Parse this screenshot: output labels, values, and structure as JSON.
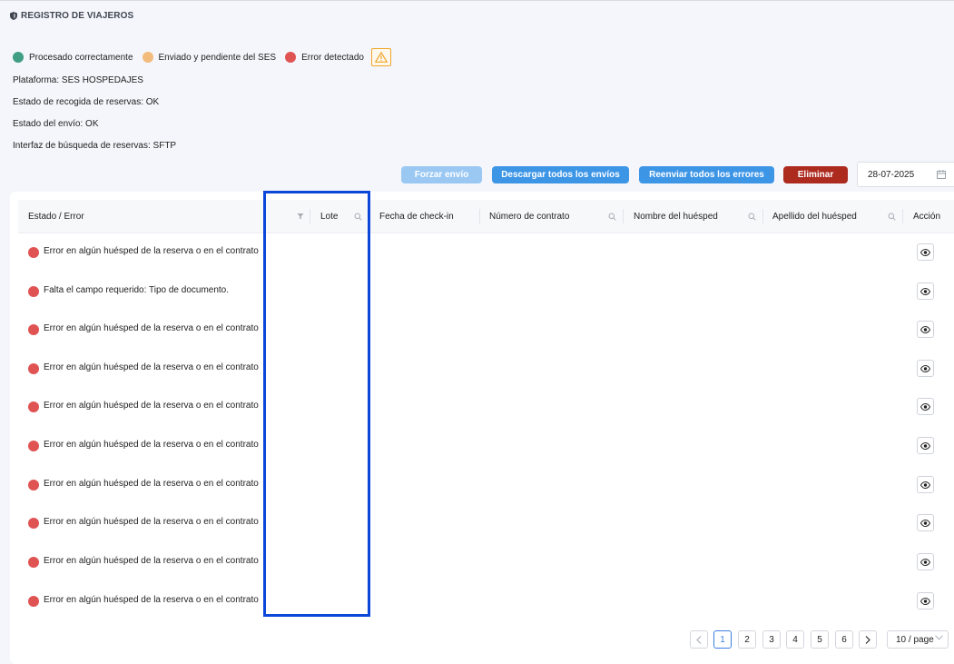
{
  "header": {
    "title": "REGISTRO DE VIAJEROS",
    "icon": "shield-icon"
  },
  "legend": [
    {
      "label": "Procesado correctamente",
      "color": "#3f9e84"
    },
    {
      "label": "Enviado y pendiente del SES",
      "color": "#f3bb7c"
    },
    {
      "label": "Error detectado",
      "color": "#e05353"
    }
  ],
  "info": {
    "platform": "Plataforma: SES HOSPEDAJES",
    "collection_status": "Estado de recogida de reservas: OK",
    "send_status": "Estado del envío: OK",
    "search_interface": "Interfaz de búsqueda de reservas: SFTP"
  },
  "toolbar": {
    "force_label": "Forzar envío",
    "download_label": "Descargar todos los envíos",
    "resend_label": "Reenviar todos los errores",
    "delete_label": "Eliminar",
    "date_value": "28-07-2025"
  },
  "table": {
    "columns": {
      "status": "Estado / Error",
      "batch": "Lote",
      "checkin": "Fecha de check-in",
      "contract": "Número de contrato",
      "guest_name": "Nombre del huésped",
      "guest_surname": "Apellido del huésped",
      "action": "Acción"
    },
    "rows": [
      {
        "message": "Error en algún huésped de la reserva o en el contrato"
      },
      {
        "message": "Falta el campo requerido: Tipo de documento."
      },
      {
        "message": "Error en algún huésped de la reserva o en el contrato"
      },
      {
        "message": "Error en algún huésped de la reserva o en el contrato"
      },
      {
        "message": "Error en algún huésped de la reserva o en el contrato"
      },
      {
        "message": "Error en algún huésped de la reserva o en el contrato"
      },
      {
        "message": "Error en algún huésped de la reserva o en el contrato"
      },
      {
        "message": "Error en algún huésped de la reserva o en el contrato"
      },
      {
        "message": "Error en algún huésped de la reserva o en el contrato"
      },
      {
        "message": "Error en algún huésped de la reserva o en el contrato"
      }
    ]
  },
  "pagination": {
    "pages": [
      "1",
      "2",
      "3",
      "4",
      "5",
      "6"
    ],
    "current": "1",
    "page_size": "10 / page"
  },
  "colors": {
    "primary": "#3d95e6",
    "primary_disabled": "#9ac8f3",
    "danger": "#ad2a1f",
    "error_dot": "#e05353",
    "highlight": "#0b48d9"
  }
}
